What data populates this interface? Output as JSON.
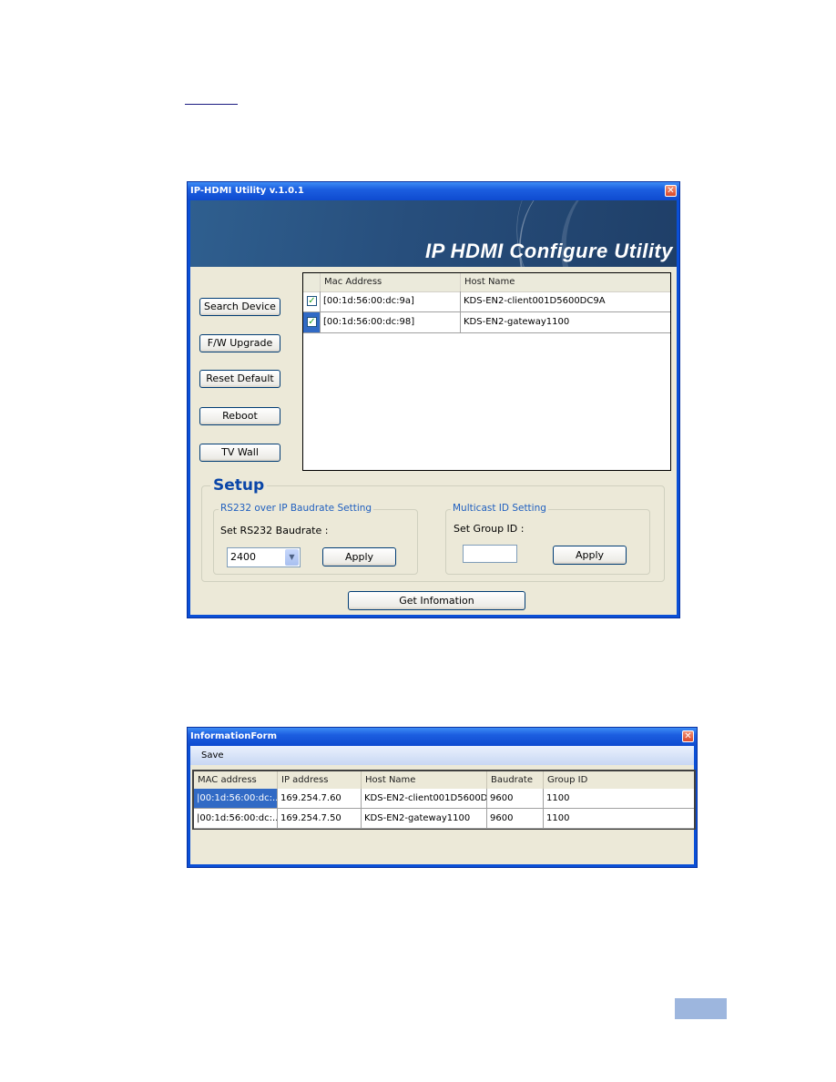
{
  "main_window": {
    "title": "IP-HDMI Utility v.1.0.1",
    "close_glyph": "✕",
    "banner_title": "IP HDMI Configure Utility",
    "side_buttons": [
      {
        "label": "Search Device"
      },
      {
        "label": "F/W Upgrade"
      },
      {
        "label": "Reset Default"
      },
      {
        "label": "Reboot"
      },
      {
        "label": "TV Wall"
      }
    ],
    "device_list": {
      "columns": [
        "",
        "Mac Address",
        "Host Name"
      ],
      "rows": [
        {
          "checked": true,
          "check_glyph": "✓",
          "mac": "[00:1d:56:00:dc:9a]",
          "host": "KDS-EN2-client001D5600DC9A"
        },
        {
          "checked": true,
          "check_glyph": "✓",
          "mac": "[00:1d:56:00:dc:98]",
          "host": "KDS-EN2-gateway1100"
        }
      ]
    },
    "setup": {
      "title": "Setup",
      "rs232": {
        "group_title": "RS232 over IP Baudrate Setting",
        "label": "Set RS232 Baudrate :",
        "selected_baudrate": "2400",
        "dropdown_glyph": "▼",
        "apply_label": "Apply"
      },
      "multicast": {
        "group_title": "Multicast ID Setting",
        "label": "Set Group ID :",
        "group_id_value": "",
        "apply_label": "Apply"
      }
    },
    "get_info_label": "Get Infomation"
  },
  "info_window": {
    "title": "InformationForm",
    "close_glyph": "✕",
    "menu": [
      "Save"
    ],
    "columns": [
      "MAC address",
      "IP address",
      "Host Name",
      "Baudrate",
      "Group ID"
    ],
    "rows": [
      [
        "|00:1d:56:00:dc:...",
        "169.254.7.60",
        "KDS-EN2-client001D5600D...",
        "9600",
        "1100"
      ],
      [
        "|00:1d:56:00:dc:...",
        "169.254.7.50",
        "KDS-EN2-gateway1100",
        "9600",
        "1100"
      ]
    ]
  }
}
